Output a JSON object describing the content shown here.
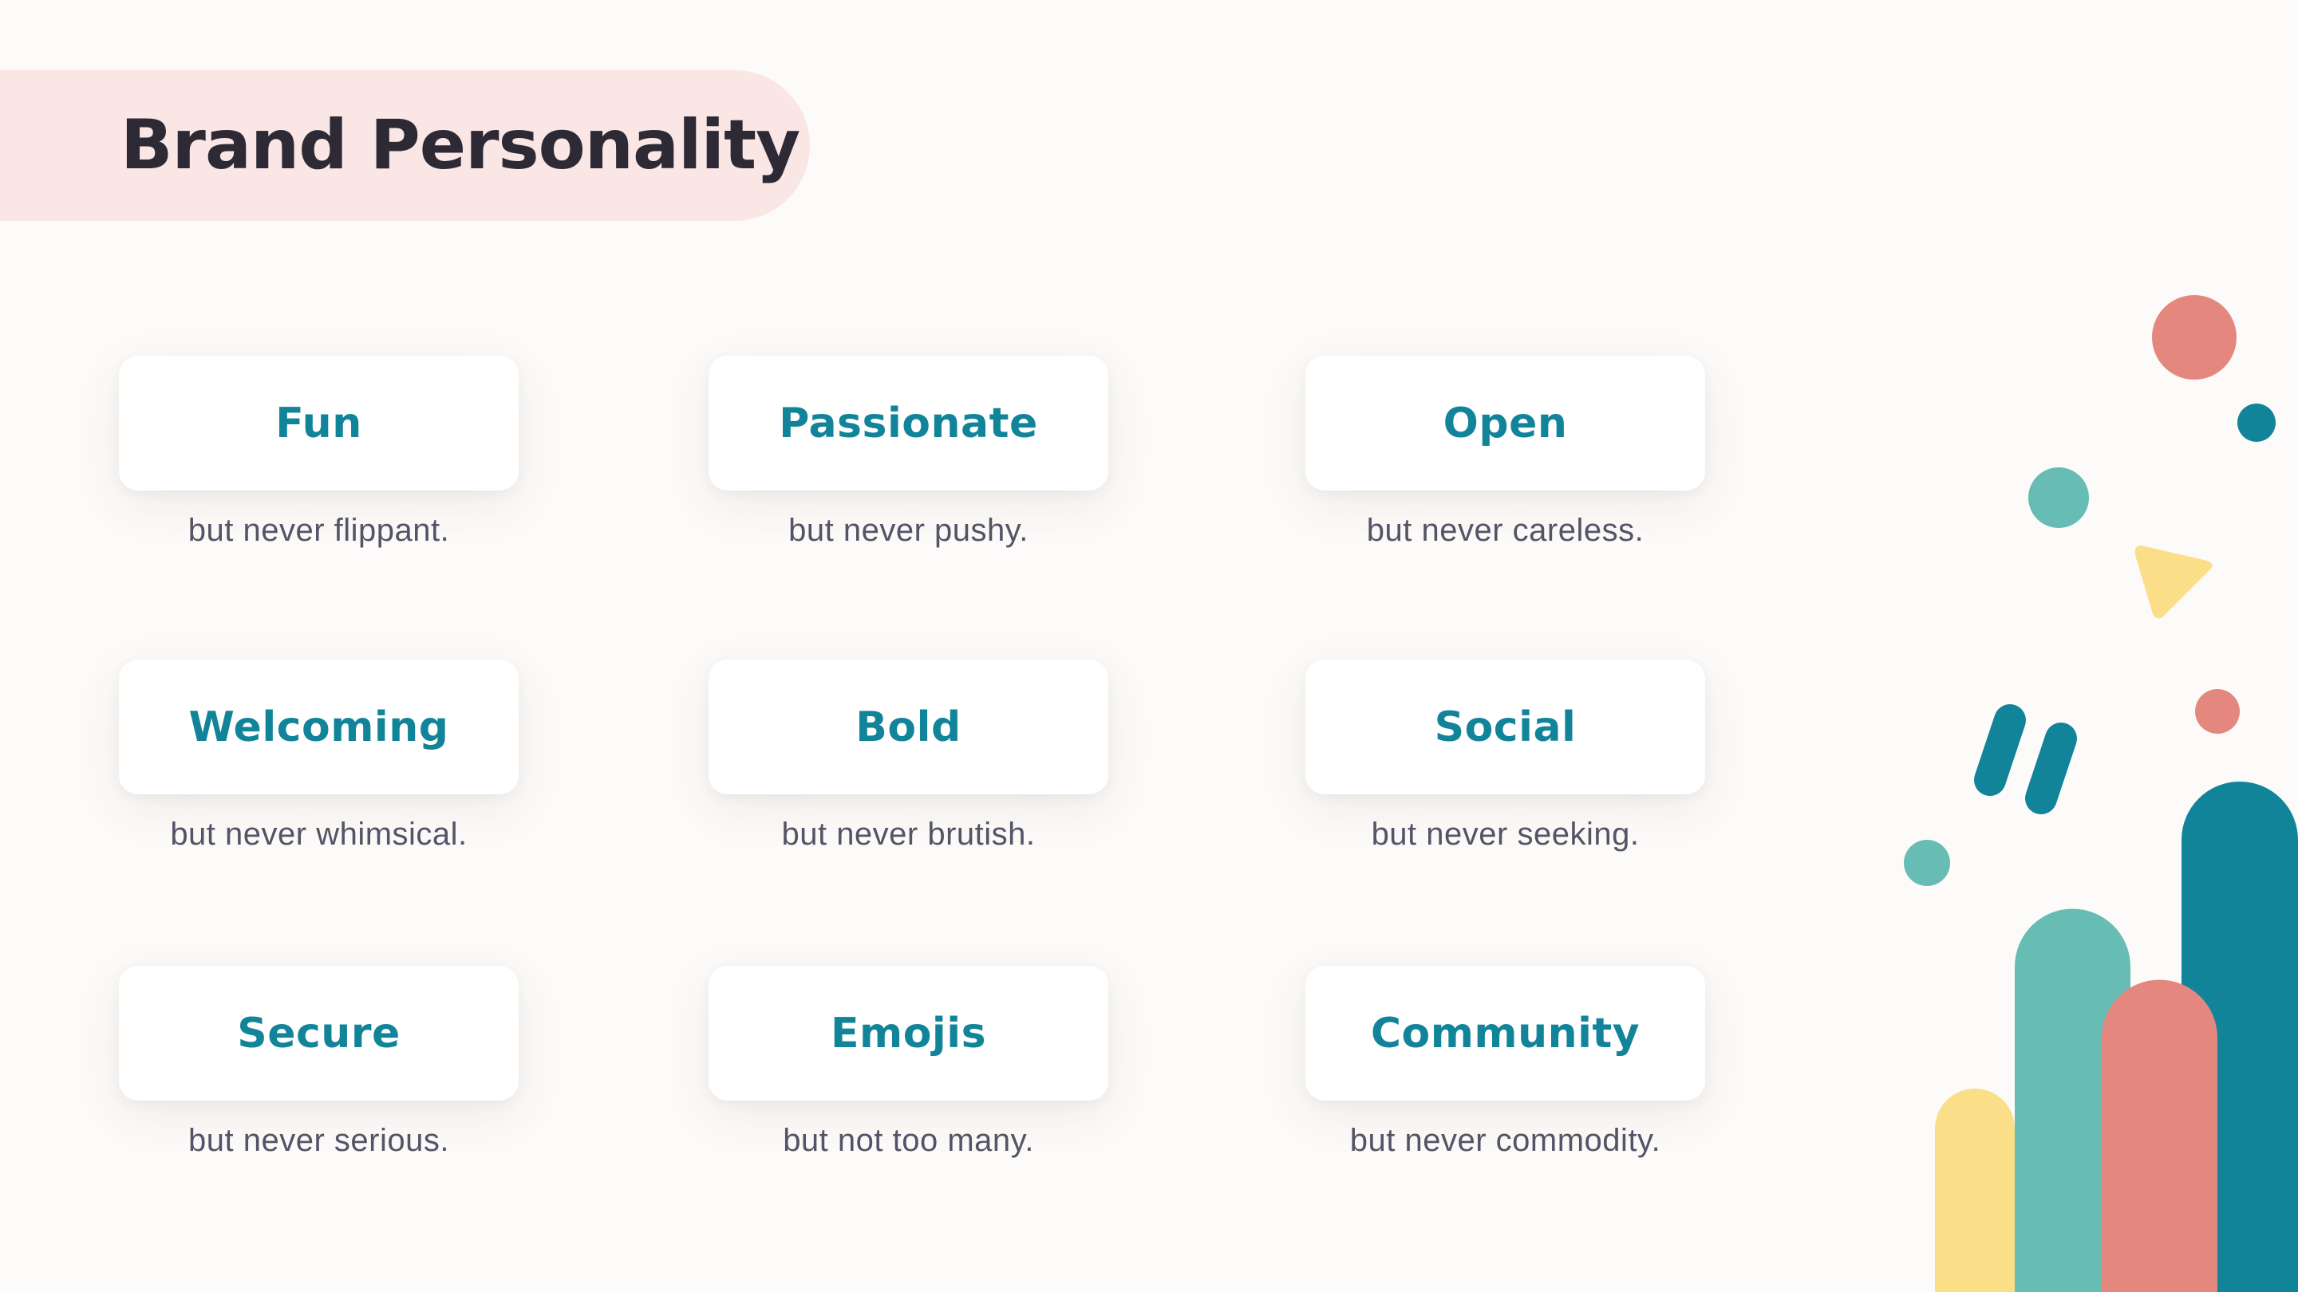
{
  "header": {
    "title": "Brand Personality"
  },
  "traits": [
    {
      "title": "Fun",
      "subtitle": "but never flippant."
    },
    {
      "title": "Passionate",
      "subtitle": "but never pushy."
    },
    {
      "title": "Open",
      "subtitle": "but never careless."
    },
    {
      "title": "Welcoming",
      "subtitle": "but never whimsical."
    },
    {
      "title": "Bold",
      "subtitle": "but never brutish."
    },
    {
      "title": "Social",
      "subtitle": "but never seeking."
    },
    {
      "title": "Secure",
      "subtitle": "but never serious."
    },
    {
      "title": "Emojis",
      "subtitle": "but not too many."
    },
    {
      "title": "Community",
      "subtitle": "but never commodity."
    }
  ],
  "colors": {
    "background": "#FDFBF9",
    "header_band": "#F9E6E5",
    "title_text": "#2D2A35",
    "accent_teal_dark": "#12849A",
    "accent_teal_light": "#67BCB3",
    "accent_coral": "#E4877F",
    "accent_yellow": "#FBDE88",
    "subtitle_text": "#555366"
  }
}
